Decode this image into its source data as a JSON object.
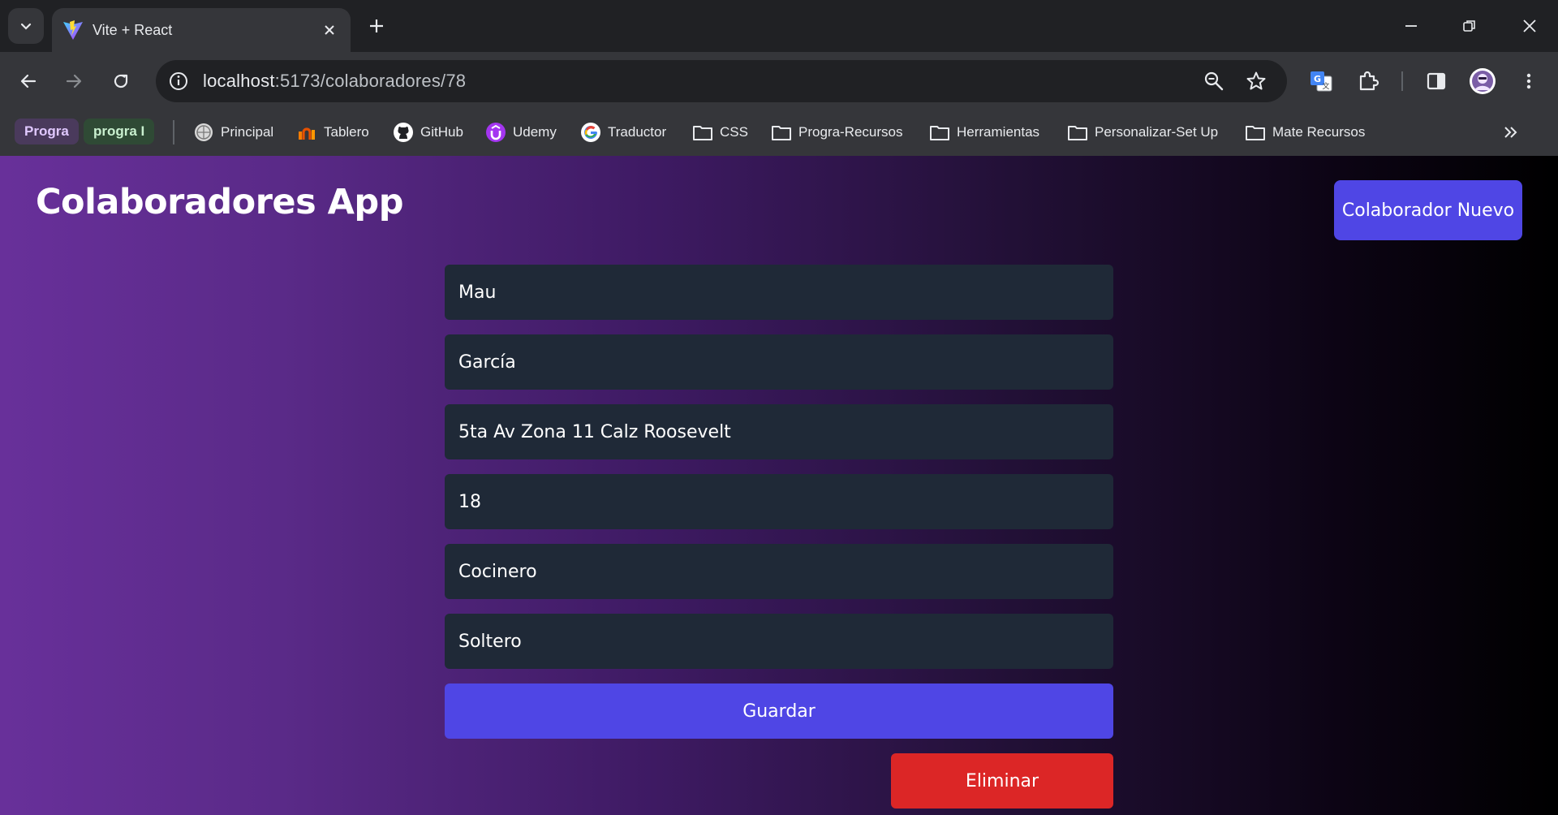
{
  "browser": {
    "tab": {
      "title": "Vite + React"
    },
    "omnibox": {
      "host": "localhost",
      "path": ":5173/colaboradores/78"
    },
    "bookmarks": {
      "chips": [
        {
          "label": "Progra",
          "bg": "#4a3a5c",
          "color": "#e0c8ff"
        },
        {
          "label": "progra I",
          "bg": "#2f4a35",
          "color": "#c9f0cf"
        }
      ],
      "items": [
        {
          "label": "Principal",
          "icon": "globe-icon"
        },
        {
          "label": "Tablero",
          "icon": "tablero-icon"
        },
        {
          "label": "GitHub",
          "icon": "github-icon"
        },
        {
          "label": "Udemy",
          "icon": "udemy-icon"
        },
        {
          "label": "Traductor",
          "icon": "google-icon"
        },
        {
          "label": "CSS",
          "icon": "folder-icon"
        },
        {
          "label": "Progra-Recursos",
          "icon": "folder-icon"
        },
        {
          "label": "Herramientas",
          "icon": "folder-icon"
        },
        {
          "label": "Personalizar-Set Up",
          "icon": "folder-icon"
        },
        {
          "label": "Mate Recursos",
          "icon": "folder-icon"
        }
      ]
    }
  },
  "app": {
    "title": "Colaboradores App",
    "new_button": "Colaborador Nuevo",
    "form": {
      "fields": [
        {
          "name": "nombre",
          "value": "Mau"
        },
        {
          "name": "apellido",
          "value": "García"
        },
        {
          "name": "direccion",
          "value": "5ta Av Zona 11 Calz Roosevelt"
        },
        {
          "name": "edad",
          "value": "18"
        },
        {
          "name": "puesto",
          "value": "Cocinero"
        },
        {
          "name": "estado-civil",
          "value": "Soltero"
        }
      ],
      "save_label": "Guardar",
      "delete_label": "Eliminar"
    }
  },
  "colors": {
    "primary": "#4f46e5",
    "danger": "#dc2626",
    "input_bg": "#1f2937"
  }
}
